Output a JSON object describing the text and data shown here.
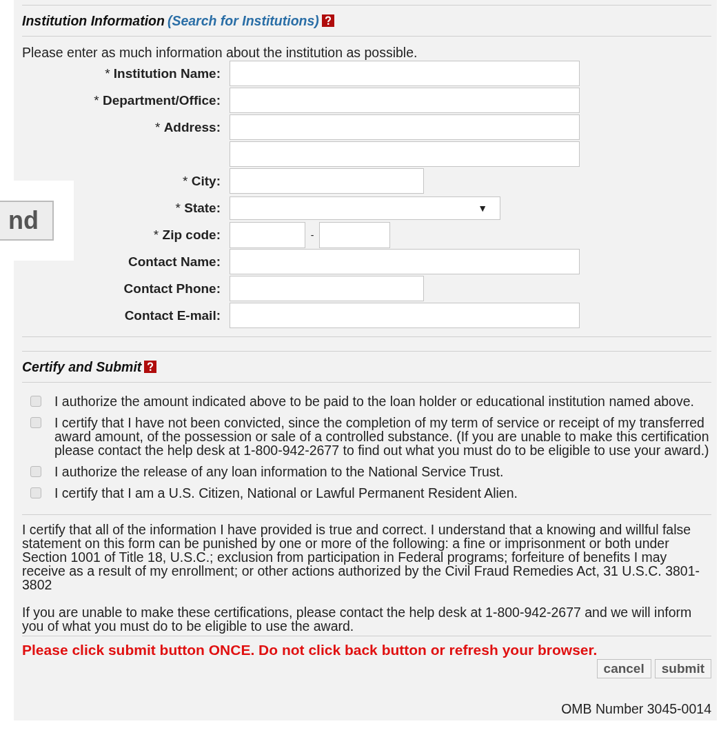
{
  "overlay_button": {
    "label": "nd"
  },
  "institution": {
    "title": "Institution Information",
    "link": "(Search for Institutions)",
    "intro": "Please enter as much information about the institution as possible.",
    "fields": [
      {
        "kind": "long",
        "marker": "*",
        "label": "Institution Name:"
      },
      {
        "kind": "long",
        "marker": "*",
        "label": "Department/Office:"
      },
      {
        "kind": "long",
        "marker": "*",
        "label": "Address:"
      },
      {
        "kind": "long"
      },
      {
        "kind": "short",
        "marker": "*",
        "label": "City:"
      },
      {
        "kind": "select",
        "marker": "*",
        "label": "State:",
        "arrow": "▼"
      },
      {
        "kind": "zip",
        "marker": "*",
        "label": "Zip code:",
        "separator": "-"
      },
      {
        "kind": "long",
        "label": "Contact Name:"
      },
      {
        "kind": "short",
        "label": "Contact Phone:"
      },
      {
        "kind": "long",
        "label": "Contact E-mail:"
      }
    ]
  },
  "certify": {
    "title": "Certify and Submit",
    "checkboxes": [
      {
        "checked": false,
        "text": "I authorize the amount indicated above to be paid to the loan holder or educational institution named above."
      },
      {
        "checked": false,
        "text": "I certify that I have not been convicted, since the completion of my term of service or receipt of my transferred award amount, of the possession or sale of a controlled substance. (If you are unable to make this certification please contact the help desk at 1-800-942-2677 to find out what you must do to be eligible to use your award.)"
      },
      {
        "checked": false,
        "text": "I authorize the release of any loan information to the National Service Trust."
      },
      {
        "checked": false,
        "text": "I certify that I am a U.S. Citizen, National or Lawful Permanent Resident Alien."
      }
    ],
    "statements": [
      "I certify that all of the information I have provided is true and correct. I understand that a knowing and willful false statement on this form can be punished by one or more of the following: a fine or imprisonment or both under Section 1001 of Title 18, U.S.C.; exclusion from participation in Federal programs; forfeiture of benefits I may receive as a result of my enrollment; or other actions authorized by the Civil Fraud Remedies Act, 31 U.S.C. 3801-3802",
      "If you are unable to make these certifications, please contact the help desk at 1-800-942-2677 and we will inform you of what you must do to be eligible to use the award."
    ],
    "warning": "Please click submit button ONCE. Do not click back button or refresh your browser.",
    "buttons": [
      "cancel",
      "submit"
    ],
    "omb": "OMB Number 3045-0014"
  }
}
